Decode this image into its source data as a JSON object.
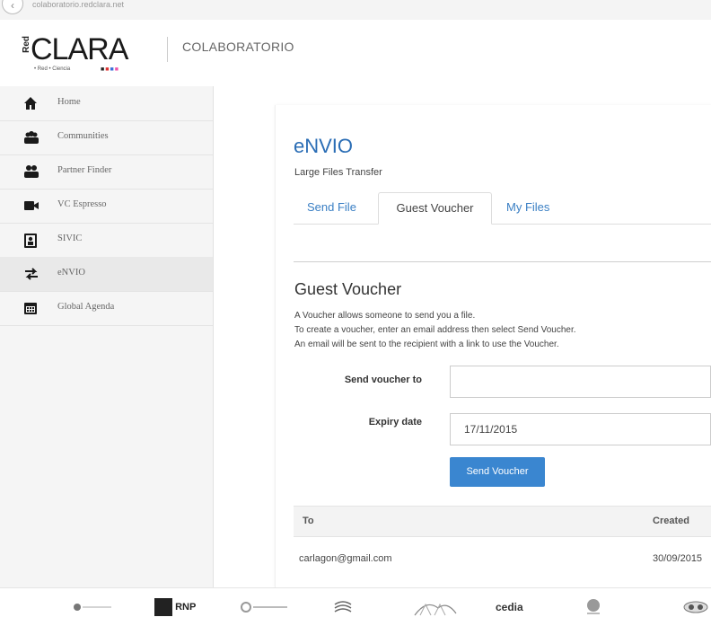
{
  "browser": {
    "url": "colaboratorio.redclara.net"
  },
  "header": {
    "logo": {
      "red": "Red",
      "clara": "CLARA",
      "sub": "• Red • Ciencia",
      "dots": "■ ■ ■ ■"
    },
    "title": "COLABORATORIO"
  },
  "sidebar": {
    "items": [
      {
        "label": "Home",
        "icon": "home-icon"
      },
      {
        "label": "Communities",
        "icon": "communities-icon"
      },
      {
        "label": "Partner Finder",
        "icon": "partner-finder-icon"
      },
      {
        "label": "VC Espresso",
        "icon": "video-camera-icon"
      },
      {
        "label": "SIVIC",
        "icon": "sivic-icon"
      },
      {
        "label": "eNVIO",
        "icon": "transfer-arrows-icon",
        "active": true
      },
      {
        "label": "Global Agenda",
        "icon": "calendar-icon"
      }
    ]
  },
  "envio": {
    "title": "eNVIO",
    "subtitle": "Large Files Transfer",
    "tabs": [
      "Send File",
      "Guest Voucher",
      "My Files"
    ],
    "active_tab": "Guest Voucher"
  },
  "guest_voucher": {
    "title": "Guest Voucher",
    "desc": [
      "A Voucher allows someone to send you a file.",
      "To create a voucher, enter an email address then select Send Voucher.",
      "An email will be sent to the recipient with a link to use the Voucher."
    ],
    "send_to_label": "Send voucher to",
    "send_to_value": "",
    "expiry_label": "Expiry date",
    "expiry_value": "17/11/2015",
    "button": "Send Voucher"
  },
  "table": {
    "headers": [
      "To",
      "Created"
    ],
    "rows": [
      {
        "to": "carlagon@gmail.com",
        "created": "30/09/2015"
      }
    ]
  },
  "footer": {
    "partners": [
      "rnp"
    ],
    "rnp_text": "RNP",
    "cedia_text": "cedia"
  },
  "colors": {
    "link": "#3a7fc4",
    "button": "#3a86d0",
    "title": "#2a6db5"
  }
}
